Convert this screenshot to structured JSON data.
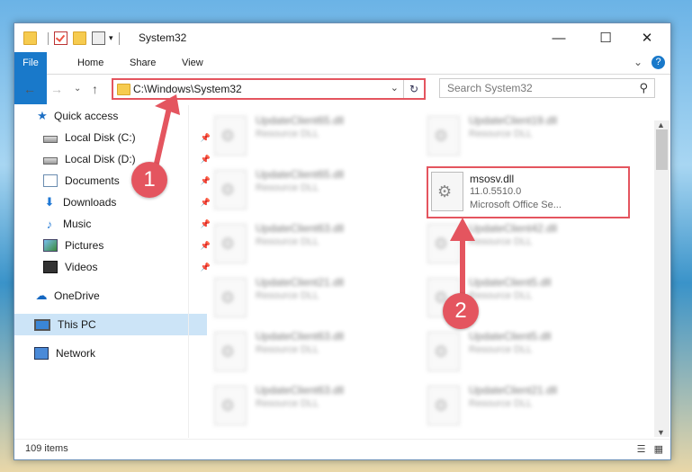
{
  "window": {
    "title": "System32",
    "controls": {
      "minimize": "—",
      "maximize": "☐",
      "close": "✕"
    }
  },
  "ribbon": {
    "tabs": [
      "File",
      "Home",
      "Share",
      "View"
    ],
    "expand": "⌄",
    "help": "?"
  },
  "address": {
    "path": "C:\\Windows\\System32",
    "dropdown": "⌄",
    "refresh": "↻",
    "search_placeholder": "Search System32"
  },
  "nav": {
    "back": "←",
    "forward": "→",
    "recent": "⌄",
    "up": "↑"
  },
  "sidebar": {
    "items": [
      {
        "label": "Quick access"
      },
      {
        "label": "Local Disk (C:)"
      },
      {
        "label": "Local Disk (D:)"
      },
      {
        "label": "Documents"
      },
      {
        "label": "Downloads"
      },
      {
        "label": "Music"
      },
      {
        "label": "Pictures"
      },
      {
        "label": "Videos"
      },
      {
        "label": "OneDrive"
      },
      {
        "label": "This PC"
      },
      {
        "label": "Network"
      }
    ]
  },
  "files": [
    {
      "name": "UpdateClient65.dll",
      "type": "Resource DLL"
    },
    {
      "name": "UpdateClient19.dll",
      "type": "Resource DLL"
    },
    {
      "name": "UpdateClient65.dll",
      "type": "Resource DLL"
    },
    {
      "name": "msosv.dll",
      "version": "11.0.5510.0",
      "type": "Microsoft Office Se..."
    },
    {
      "name": "UpdateClient63.dll",
      "type": "Resource DLL"
    },
    {
      "name": "UpdateClient42.dll",
      "type": "Resource DLL"
    },
    {
      "name": "UpdateClient21.dll",
      "type": "Resource DLL"
    },
    {
      "name": "UpdateClient5.dll",
      "type": "Resource DLL"
    },
    {
      "name": "UpdateClient63.dll",
      "type": "Resource DLL"
    },
    {
      "name": "UpdateClient5.dll",
      "type": "Resource DLL"
    },
    {
      "name": "UpdateClient63.dll",
      "type": "Resource DLL"
    },
    {
      "name": "UpdateClient21.dll",
      "type": "Resource DLL"
    }
  ],
  "status": {
    "count": "109 items"
  },
  "annotations": {
    "step1": "1",
    "step2": "2",
    "color": "#e4555f"
  }
}
